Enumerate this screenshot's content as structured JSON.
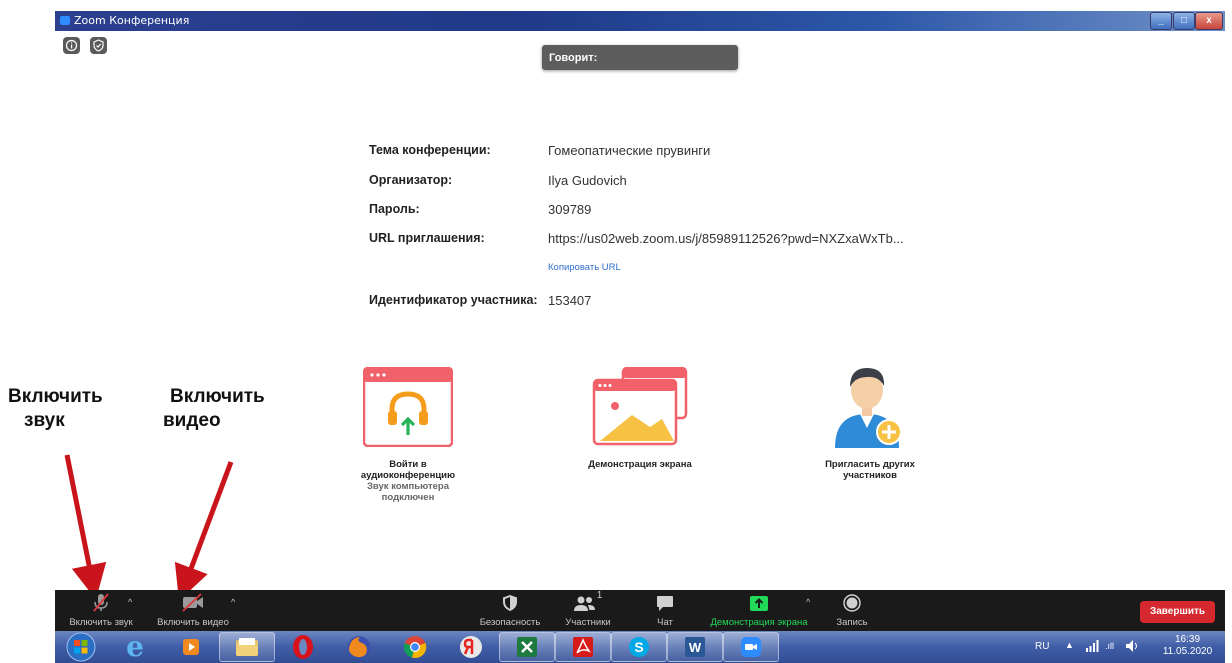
{
  "window": {
    "title": "Zoom Конференция",
    "minimize": "_",
    "maximize": "□",
    "close": "x"
  },
  "top_icons": [
    "info-icon",
    "shield-icon"
  ],
  "speaker": {
    "label": "Говорит:"
  },
  "meeting_info": {
    "topic_label": "Тема конференции:",
    "topic_value": "Гомеопатические прувинги",
    "host_label": "Организатор:",
    "host_value": "Ilya Gudovich",
    "password_label": "Пароль:",
    "password_value": "309789",
    "url_label": "URL приглашения:",
    "url_value": "https://us02web.zoom.us/j/85989112526?pwd=NXZxaWxTb...",
    "copy_url": "Копировать URL",
    "participant_id_label": "Идентификатор участника:",
    "participant_id_value": "153407"
  },
  "actions": {
    "audio": {
      "line1": "Войти в",
      "line2": "аудиоконференцию",
      "sub1": "Звук компьютера",
      "sub2": "подключен"
    },
    "share": {
      "label": "Демонстрация экрана"
    },
    "invite": {
      "line1": "Пригласить других",
      "line2": "участников"
    }
  },
  "annotations": {
    "audio_line1": "Включить",
    "audio_line2": "звук",
    "video_line1": "Включить",
    "video_line2": "видео"
  },
  "toolbar": {
    "unmute": "Включить звук",
    "start_video": "Включить видео",
    "security": "Безопасность",
    "participants": "Участники",
    "participants_count": "1",
    "chat": "Чат",
    "share_screen": "Демонстрация экрана",
    "record": "Запись",
    "end": "Завершить",
    "caret": "^"
  },
  "taskbar": {
    "apps": [
      "windows-start",
      "internet-explorer",
      "media-player",
      "file-explorer",
      "opera",
      "firefox",
      "chrome",
      "yandex",
      "excel",
      "acrobat",
      "skype",
      "word",
      "zoom"
    ],
    "lang": "RU",
    "time": "16:39",
    "date": "11.05.2020"
  },
  "colors": {
    "toolbar_bg": "#1a1a1a",
    "share_green": "#23d959",
    "end_red": "#d6292f",
    "link_blue": "#2f6fcf",
    "arrow_red": "#c9141b"
  }
}
